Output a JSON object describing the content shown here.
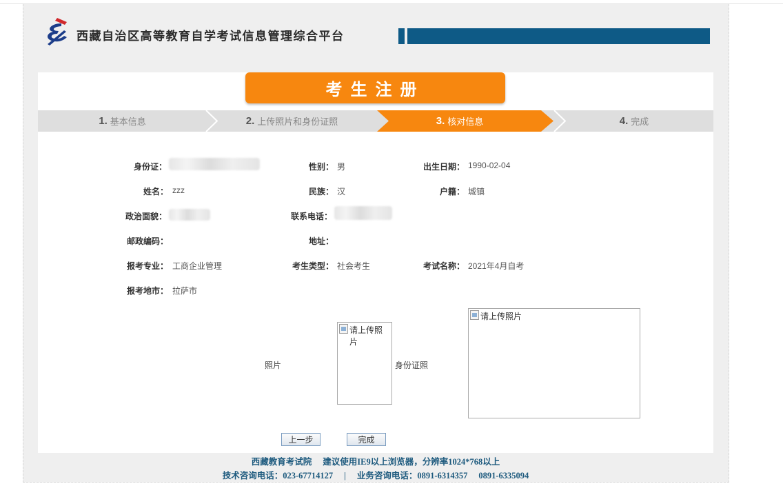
{
  "header": {
    "site_title": "西藏自治区高等教育自学考试信息管理综合平台"
  },
  "banner": {
    "title": "考生注册"
  },
  "steps": [
    {
      "num": "1.",
      "label": "基本信息",
      "active": false
    },
    {
      "num": "2.",
      "label": "上传照片和身份证照",
      "active": false
    },
    {
      "num": "3.",
      "label": "核对信息",
      "active": true
    },
    {
      "num": "4.",
      "label": "完成",
      "active": false
    }
  ],
  "form": {
    "id_card": {
      "label": "身份证：",
      "value": ""
    },
    "gender": {
      "label": "性别：",
      "value": "男"
    },
    "birth": {
      "label": "出生日期：",
      "value": "1990-02-04"
    },
    "name": {
      "label": "姓名：",
      "value": "zzz"
    },
    "ethnicity": {
      "label": "民族：",
      "value": "汉"
    },
    "hukou": {
      "label": "户籍：",
      "value": "城镇"
    },
    "political": {
      "label": "政治面貌：",
      "value": ""
    },
    "phone": {
      "label": "联系电话：",
      "value": ""
    },
    "postcode": {
      "label": "邮政编码：",
      "value": ""
    },
    "address": {
      "label": "地址：",
      "value": ""
    },
    "major": {
      "label": "报考专业：",
      "value": "工商企业管理"
    },
    "candidate_type": {
      "label": "考生类型：",
      "value": "社会考生"
    },
    "exam_name": {
      "label": "考试名称：",
      "value": "2021年4月自考"
    },
    "city": {
      "label": "报考地市：",
      "value": "拉萨市"
    }
  },
  "photos": {
    "photo_label": "照片",
    "photo_alt": "请上传照片",
    "id_label": "身份证照",
    "id_alt": "请上传照片"
  },
  "buttons": {
    "prev": "上一步",
    "finish": "完成"
  },
  "footer": {
    "org": "西藏教育考试院",
    "browser_tip": "建议使用IE9以上浏览器，分辨率1024*768以上",
    "tech_phone": "技术咨询电话：023-67714127",
    "separator": "|",
    "biz_phone": "业务咨询电话：0891-6314357",
    "biz_phone2": "0891-6335094"
  },
  "colors": {
    "accent": "#f7870f",
    "header_bar": "#0e5a86",
    "footer_text": "#1d5a7e"
  }
}
